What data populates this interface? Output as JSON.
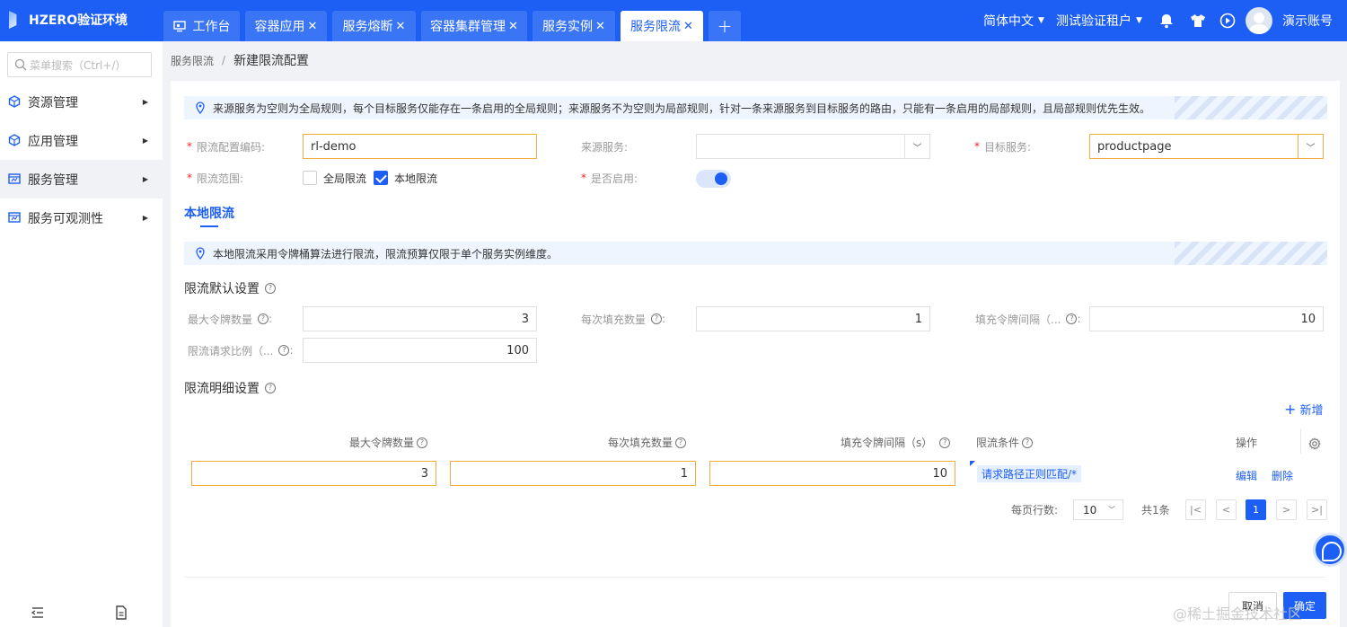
{
  "app": {
    "title": "HZERO验证环境"
  },
  "tabs": [
    {
      "label": "工作台",
      "closable": false,
      "active": false
    },
    {
      "label": "容器应用",
      "closable": true,
      "active": false
    },
    {
      "label": "服务熔断",
      "closable": true,
      "active": false
    },
    {
      "label": "容器集群管理",
      "closable": true,
      "active": false
    },
    {
      "label": "服务实例",
      "closable": true,
      "active": false
    },
    {
      "label": "服务限流",
      "closable": true,
      "active": true
    }
  ],
  "header": {
    "language": "简体中文",
    "tenant": "测试验证租户",
    "user": "演示账号"
  },
  "sidebar": {
    "search_placeholder": "菜单搜索（Ctrl+/）",
    "items": [
      {
        "label": "资源管理",
        "active": false
      },
      {
        "label": "应用管理",
        "active": false
      },
      {
        "label": "服务管理",
        "active": true
      },
      {
        "label": "服务可观测性",
        "active": false
      }
    ]
  },
  "breadcrumb": {
    "parent": "服务限流",
    "separator": "/",
    "current": "新建限流配置"
  },
  "form": {
    "notice": "来源服务为空则为全局规则，每个目标服务仅能存在一条启用的全局规则；来源服务不为空则为局部规则，针对一条来源服务到目标服务的路由，只能有一条启用的局部规则，且局部规则优先生效。",
    "required_mark": "*",
    "code_label": "限流配置编码:",
    "code_value": "rl-demo",
    "source_label": "来源服务:",
    "source_value": "",
    "target_label": "目标服务:",
    "target_value": "productpage",
    "scope_label": "限流范围:",
    "scope_global": "全局限流",
    "scope_global_checked": false,
    "scope_local": "本地限流",
    "scope_local_checked": true,
    "enabled_label": "是否启用:",
    "enabled": true
  },
  "local": {
    "tab_title": "本地限流",
    "notice": "本地限流采用令牌桶算法进行限流，限流预算仅限于单个服务实例维度。",
    "default_title": "限流默认设置",
    "max_tokens_label": "最大令牌数量",
    "max_tokens_value": "3",
    "tokens_per_fill_label": "每次填充数量",
    "tokens_per_fill_value": "1",
    "fill_interval_label": "填充令牌间隔（...",
    "fill_interval_value": "10",
    "ratio_label": "限流请求比例（...",
    "ratio_value": "100",
    "colon": ":",
    "detail_title": "限流明细设置",
    "add_label": "新增"
  },
  "table": {
    "headers": [
      "最大令牌数量",
      "每次填充数量",
      "填充令牌间隔（s）",
      "限流条件",
      "操作"
    ],
    "rows": [
      {
        "max_tokens": "3",
        "tokens_per_fill": "1",
        "fill_interval": "10",
        "condition": "请求路径正则匹配/*",
        "edit": "编辑",
        "delete": "删除"
      }
    ]
  },
  "pagination": {
    "rows_label": "每页行数:",
    "page_size": "10",
    "total": "共1条",
    "current_page": "1"
  },
  "footer": {
    "cancel": "取消",
    "confirm": "确定"
  },
  "watermark": "@稀土掘金技术社区",
  "colors": {
    "primary": "#1d5ff5",
    "highlight_border": "#f1ae3d",
    "required": "#f5222d",
    "notice_bg": "#eef5ff"
  }
}
